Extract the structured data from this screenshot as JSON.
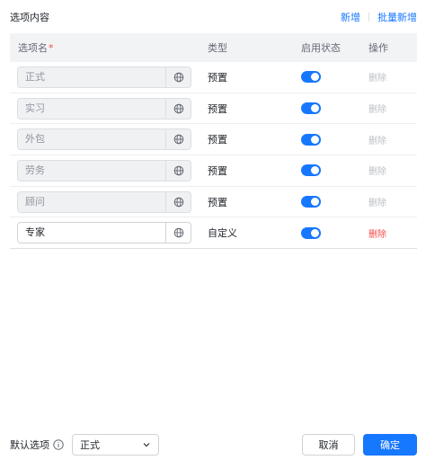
{
  "header": {
    "title": "选项内容",
    "add_label": "新增",
    "batch_add_label": "批量新增"
  },
  "table": {
    "columns": {
      "name": "选项名",
      "required_mark": "*",
      "type": "类型",
      "status": "启用状态",
      "operation": "操作"
    },
    "rows": [
      {
        "name": "正式",
        "type": "预置",
        "enabled": true,
        "delete_label": "删除",
        "editable": false
      },
      {
        "name": "实习",
        "type": "预置",
        "enabled": true,
        "delete_label": "删除",
        "editable": false
      },
      {
        "name": "外包",
        "type": "预置",
        "enabled": true,
        "delete_label": "删除",
        "editable": false
      },
      {
        "name": "劳务",
        "type": "预置",
        "enabled": true,
        "delete_label": "删除",
        "editable": false
      },
      {
        "name": "顾问",
        "type": "预置",
        "enabled": true,
        "delete_label": "删除",
        "editable": false
      },
      {
        "name": "专家",
        "type": "自定义",
        "enabled": true,
        "delete_label": "删除",
        "editable": true
      }
    ]
  },
  "footer": {
    "default_label": "默认选项",
    "default_value": "正式",
    "cancel_label": "取消",
    "confirm_label": "确定"
  },
  "colors": {
    "accent": "#1677ff",
    "danger": "#f54a45",
    "disabled_text": "#bbbfc4"
  },
  "icons": {
    "addon": "globe-icon",
    "info": "info-icon",
    "dropdown": "chevron-down-icon"
  }
}
